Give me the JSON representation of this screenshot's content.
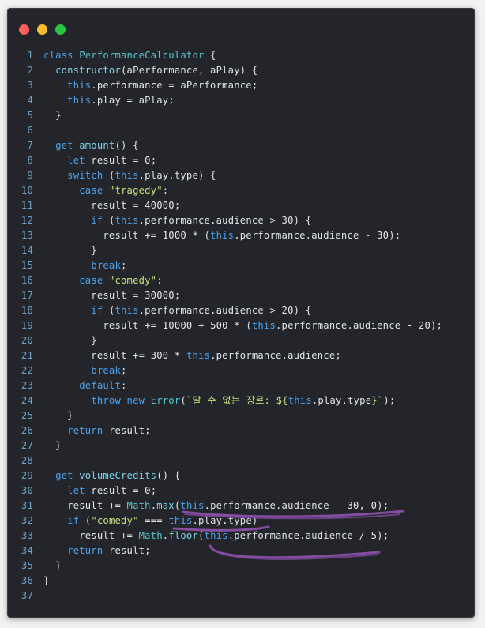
{
  "window": {
    "controls": [
      "close",
      "minimize",
      "maximize"
    ],
    "colors": {
      "close": "#fe5f57",
      "minimize": "#febc2e",
      "maximize": "#28c840",
      "background": "#23252a"
    }
  },
  "code": {
    "lines": [
      {
        "n": "1",
        "tokens": [
          [
            "kw",
            "class "
          ],
          [
            "cls",
            "PerformanceCalculator"
          ],
          [
            "plain",
            " {"
          ]
        ]
      },
      {
        "n": "2",
        "tokens": [
          [
            "plain",
            "  "
          ],
          [
            "fn",
            "constructor"
          ],
          [
            "plain",
            "(aPerformance, aPlay) {"
          ]
        ]
      },
      {
        "n": "3",
        "tokens": [
          [
            "plain",
            "    "
          ],
          [
            "kw",
            "this"
          ],
          [
            "plain",
            ".performance = aPerformance;"
          ]
        ]
      },
      {
        "n": "4",
        "tokens": [
          [
            "plain",
            "    "
          ],
          [
            "kw",
            "this"
          ],
          [
            "plain",
            ".play = aPlay;"
          ]
        ]
      },
      {
        "n": "5",
        "tokens": [
          [
            "plain",
            "  }"
          ]
        ]
      },
      {
        "n": "6",
        "tokens": []
      },
      {
        "n": "7",
        "tokens": [
          [
            "plain",
            "  "
          ],
          [
            "kw",
            "get "
          ],
          [
            "fn",
            "amount"
          ],
          [
            "plain",
            "() {"
          ]
        ]
      },
      {
        "n": "8",
        "tokens": [
          [
            "plain",
            "    "
          ],
          [
            "kw",
            "let "
          ],
          [
            "plain",
            "result = "
          ],
          [
            "num",
            "0"
          ],
          [
            "plain",
            ";"
          ]
        ]
      },
      {
        "n": "9",
        "tokens": [
          [
            "plain",
            "    "
          ],
          [
            "kw",
            "switch "
          ],
          [
            "plain",
            "("
          ],
          [
            "kw",
            "this"
          ],
          [
            "plain",
            ".play.type) {"
          ]
        ]
      },
      {
        "n": "10",
        "tokens": [
          [
            "plain",
            "      "
          ],
          [
            "kw",
            "case "
          ],
          [
            "str",
            "\"tragedy\""
          ],
          [
            "plain",
            ":"
          ]
        ]
      },
      {
        "n": "11",
        "tokens": [
          [
            "plain",
            "        result = "
          ],
          [
            "num",
            "40000"
          ],
          [
            "plain",
            ";"
          ]
        ]
      },
      {
        "n": "12",
        "tokens": [
          [
            "plain",
            "        "
          ],
          [
            "kw",
            "if "
          ],
          [
            "plain",
            "("
          ],
          [
            "kw",
            "this"
          ],
          [
            "plain",
            ".performance.audience > "
          ],
          [
            "num",
            "30"
          ],
          [
            "plain",
            ") {"
          ]
        ]
      },
      {
        "n": "13",
        "tokens": [
          [
            "plain",
            "          result += "
          ],
          [
            "num",
            "1000"
          ],
          [
            "plain",
            " * ("
          ],
          [
            "kw",
            "this"
          ],
          [
            "plain",
            ".performance.audience - "
          ],
          [
            "num",
            "30"
          ],
          [
            "plain",
            ");"
          ]
        ]
      },
      {
        "n": "14",
        "tokens": [
          [
            "plain",
            "        }"
          ]
        ]
      },
      {
        "n": "15",
        "tokens": [
          [
            "plain",
            "        "
          ],
          [
            "kw",
            "break"
          ],
          [
            "plain",
            ";"
          ]
        ]
      },
      {
        "n": "16",
        "tokens": [
          [
            "plain",
            "      "
          ],
          [
            "kw",
            "case "
          ],
          [
            "str",
            "\"comedy\""
          ],
          [
            "plain",
            ":"
          ]
        ]
      },
      {
        "n": "17",
        "tokens": [
          [
            "plain",
            "        result = "
          ],
          [
            "num",
            "30000"
          ],
          [
            "plain",
            ";"
          ]
        ]
      },
      {
        "n": "18",
        "tokens": [
          [
            "plain",
            "        "
          ],
          [
            "kw",
            "if "
          ],
          [
            "plain",
            "("
          ],
          [
            "kw",
            "this"
          ],
          [
            "plain",
            ".performance.audience > "
          ],
          [
            "num",
            "20"
          ],
          [
            "plain",
            ") {"
          ]
        ]
      },
      {
        "n": "19",
        "tokens": [
          [
            "plain",
            "          result += "
          ],
          [
            "num",
            "10000"
          ],
          [
            "plain",
            " + "
          ],
          [
            "num",
            "500"
          ],
          [
            "plain",
            " * ("
          ],
          [
            "kw",
            "this"
          ],
          [
            "plain",
            ".performance.audience - "
          ],
          [
            "num",
            "20"
          ],
          [
            "plain",
            ");"
          ]
        ]
      },
      {
        "n": "20",
        "tokens": [
          [
            "plain",
            "        }"
          ]
        ]
      },
      {
        "n": "21",
        "tokens": [
          [
            "plain",
            "        result += "
          ],
          [
            "num",
            "300"
          ],
          [
            "plain",
            " * "
          ],
          [
            "kw",
            "this"
          ],
          [
            "plain",
            ".performance.audience;"
          ]
        ]
      },
      {
        "n": "22",
        "tokens": [
          [
            "plain",
            "        "
          ],
          [
            "kw",
            "break"
          ],
          [
            "plain",
            ";"
          ]
        ]
      },
      {
        "n": "23",
        "tokens": [
          [
            "plain",
            "      "
          ],
          [
            "kw",
            "default"
          ],
          [
            "plain",
            ":"
          ]
        ]
      },
      {
        "n": "24",
        "tokens": [
          [
            "plain",
            "        "
          ],
          [
            "kw",
            "throw new "
          ],
          [
            "cls",
            "Error"
          ],
          [
            "plain",
            "("
          ],
          [
            "tpl",
            "`알 수 없는 장르: ${"
          ],
          [
            "kw",
            "this"
          ],
          [
            "plain",
            ".play.type"
          ],
          [
            "tpl",
            "}`"
          ],
          [
            "plain",
            ");"
          ]
        ]
      },
      {
        "n": "25",
        "tokens": [
          [
            "plain",
            "    }"
          ]
        ]
      },
      {
        "n": "26",
        "tokens": [
          [
            "plain",
            "    "
          ],
          [
            "kw",
            "return "
          ],
          [
            "plain",
            "result;"
          ]
        ]
      },
      {
        "n": "27",
        "tokens": [
          [
            "plain",
            "  }"
          ]
        ]
      },
      {
        "n": "28",
        "tokens": []
      },
      {
        "n": "29",
        "tokens": [
          [
            "plain",
            "  "
          ],
          [
            "kw",
            "get "
          ],
          [
            "fn",
            "volumeCredits"
          ],
          [
            "plain",
            "() {"
          ]
        ]
      },
      {
        "n": "30",
        "tokens": [
          [
            "plain",
            "    "
          ],
          [
            "kw",
            "let "
          ],
          [
            "plain",
            "result = "
          ],
          [
            "num",
            "0"
          ],
          [
            "plain",
            ";"
          ]
        ]
      },
      {
        "n": "31",
        "tokens": [
          [
            "plain",
            "    result += "
          ],
          [
            "cls",
            "Math"
          ],
          [
            "plain",
            "."
          ],
          [
            "fn",
            "max"
          ],
          [
            "plain",
            "("
          ],
          [
            "kw",
            "this"
          ],
          [
            "plain",
            ".performance.audience - "
          ],
          [
            "num",
            "30"
          ],
          [
            "plain",
            ", "
          ],
          [
            "num",
            "0"
          ],
          [
            "plain",
            ");"
          ]
        ]
      },
      {
        "n": "32",
        "tokens": [
          [
            "plain",
            "    "
          ],
          [
            "kw",
            "if "
          ],
          [
            "plain",
            "("
          ],
          [
            "str",
            "\"comedy\""
          ],
          [
            "plain",
            " === "
          ],
          [
            "kw",
            "this"
          ],
          [
            "plain",
            ".play.type)"
          ]
        ]
      },
      {
        "n": "33",
        "tokens": [
          [
            "plain",
            "      result += "
          ],
          [
            "cls",
            "Math"
          ],
          [
            "plain",
            "."
          ],
          [
            "fn",
            "floor"
          ],
          [
            "plain",
            "("
          ],
          [
            "kw",
            "this"
          ],
          [
            "plain",
            ".performance.audience / "
          ],
          [
            "num",
            "5"
          ],
          [
            "plain",
            ");"
          ]
        ]
      },
      {
        "n": "34",
        "tokens": [
          [
            "plain",
            "    "
          ],
          [
            "kw",
            "return "
          ],
          [
            "plain",
            "result;"
          ]
        ]
      },
      {
        "n": "35",
        "tokens": [
          [
            "plain",
            "  }"
          ]
        ]
      },
      {
        "n": "36",
        "tokens": [
          [
            "plain",
            "}"
          ]
        ]
      },
      {
        "n": "37",
        "tokens": []
      }
    ]
  },
  "annotations": {
    "marker_color": "#8a4fa8",
    "underlined_lines": [
      "31",
      "32",
      "33"
    ]
  }
}
